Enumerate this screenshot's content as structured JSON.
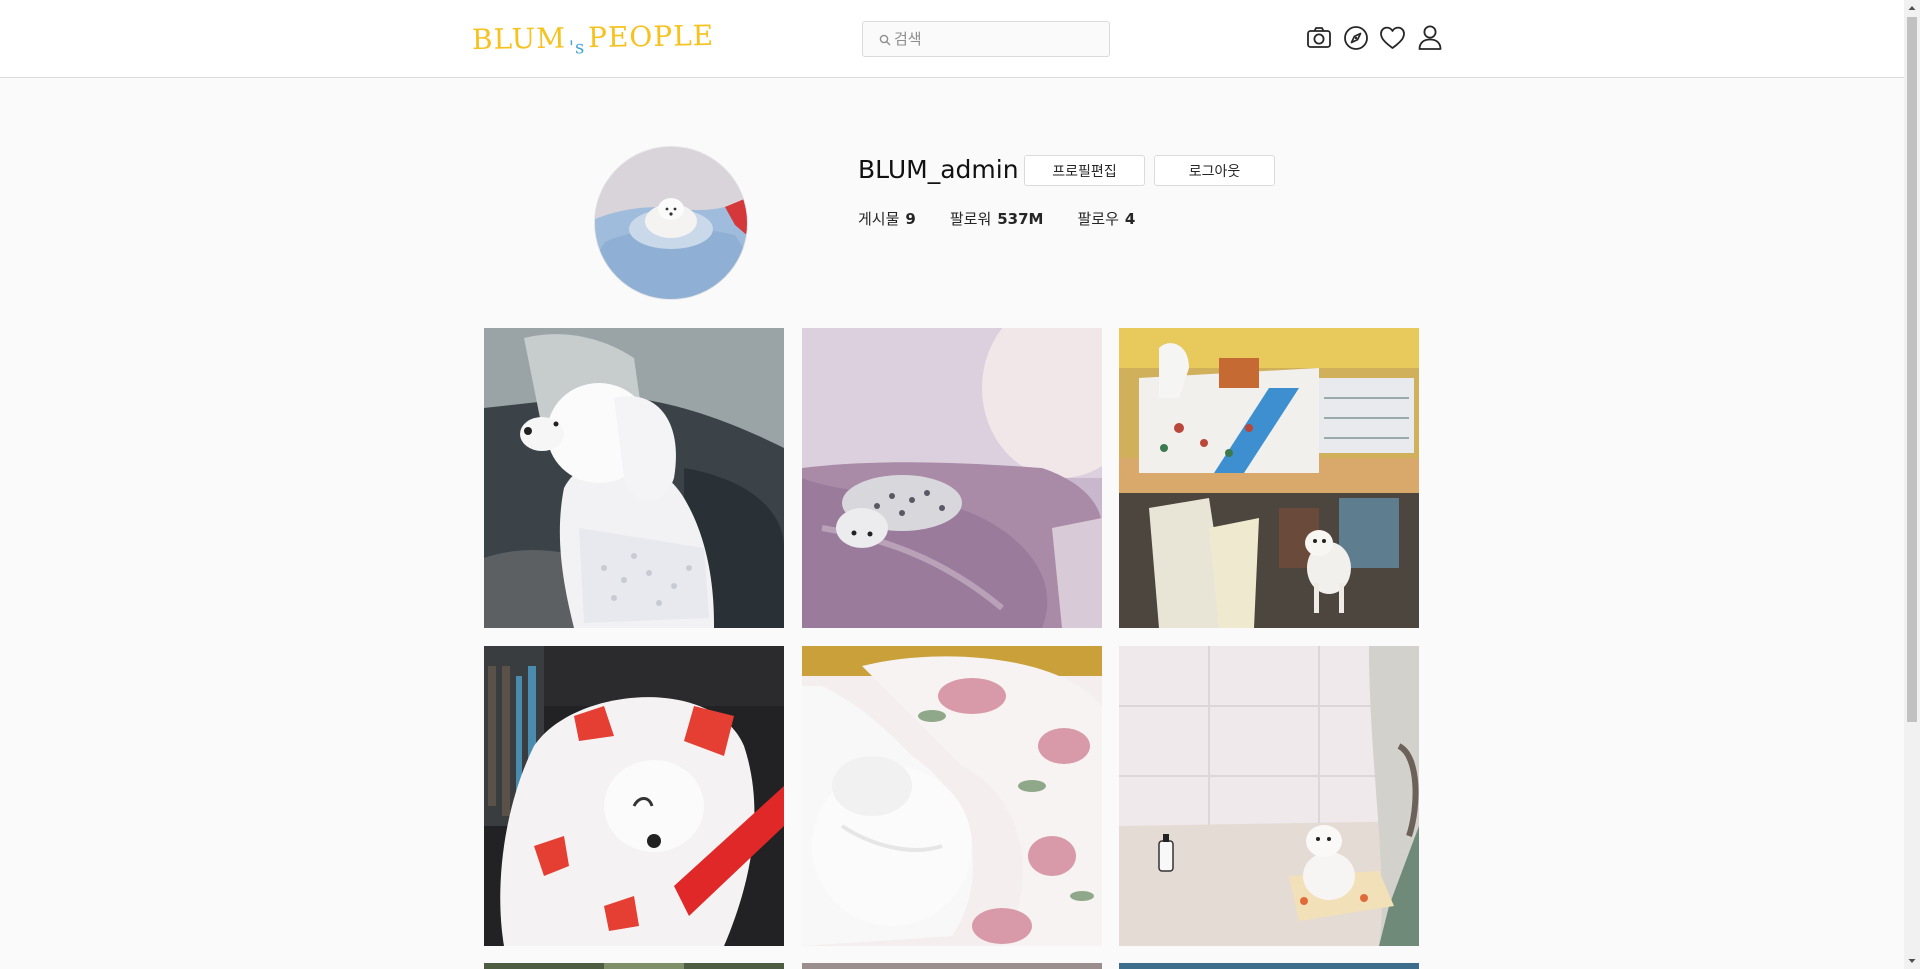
{
  "header": {
    "logo_main": "BLUM",
    "logo_apostrophe": "'s",
    "logo_tail": "PEOPLE",
    "search_placeholder": "검색",
    "search_value": ""
  },
  "nav_icons": [
    "camera-icon",
    "compass-icon",
    "heart-icon",
    "user-icon"
  ],
  "profile": {
    "username": "BLUM_admin",
    "edit_button": "프로필편집",
    "logout_button": "로그아웃",
    "stats": [
      {
        "label": "게시물",
        "value": "9"
      },
      {
        "label": "팔로워",
        "value": "537M"
      },
      {
        "label": "팔로우",
        "value": "4"
      }
    ]
  },
  "colors": {
    "logo": "#f7c11e",
    "logo_accent": "#44a6d7",
    "background": "#fafafa",
    "border": "#dbdbdb"
  }
}
